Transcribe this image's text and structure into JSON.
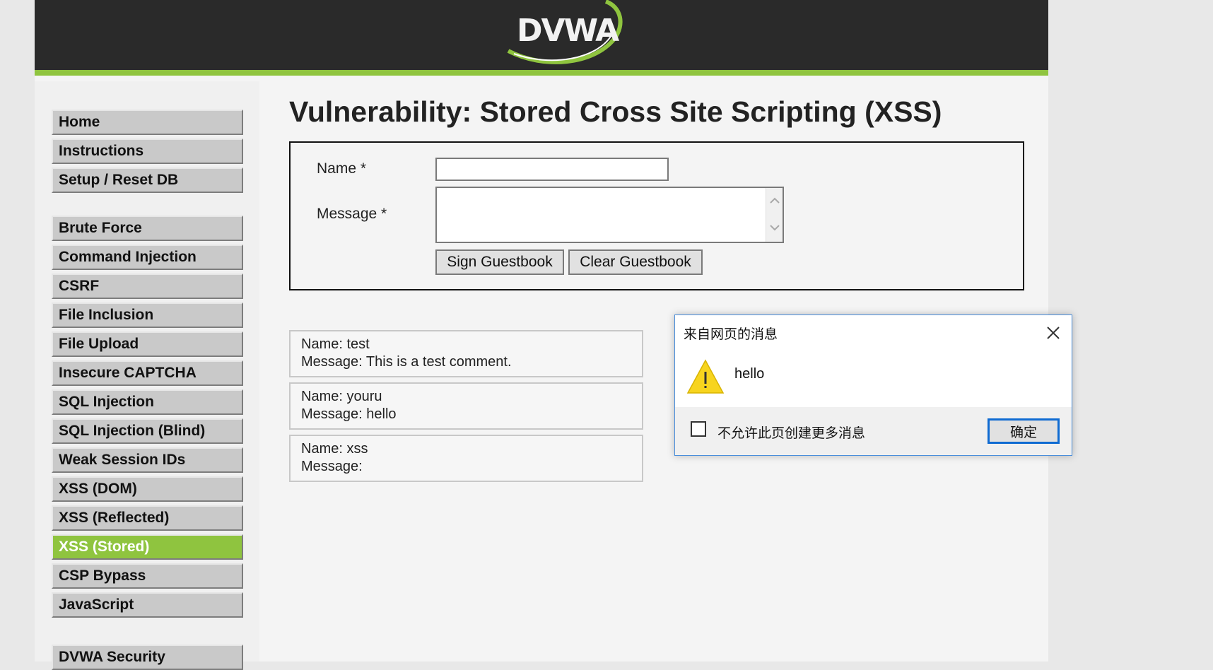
{
  "header": {
    "logo_text": "DVWA"
  },
  "sidebar": {
    "groups": [
      [
        "Home",
        "Instructions",
        "Setup / Reset DB"
      ],
      [
        "Brute Force",
        "Command Injection",
        "CSRF",
        "File Inclusion",
        "File Upload",
        "Insecure CAPTCHA",
        "SQL Injection",
        "SQL Injection (Blind)",
        "Weak Session IDs",
        "XSS (DOM)",
        "XSS (Reflected)",
        "XSS (Stored)",
        "CSP Bypass",
        "JavaScript"
      ],
      [
        "DVWA Security"
      ]
    ],
    "selected": "XSS (Stored)"
  },
  "main": {
    "title": "Vulnerability: Stored Cross Site Scripting (XSS)",
    "form": {
      "name_label": "Name *",
      "message_label": "Message *",
      "name_value": "",
      "message_value": "",
      "sign_button": "Sign Guestbook",
      "clear_button": "Clear Guestbook"
    },
    "entries": [
      {
        "name": "Name: test",
        "message": "Message: This is a test comment."
      },
      {
        "name": "Name: youru",
        "message": "Message: hello"
      },
      {
        "name": "Name: xss",
        "message": "Message:"
      }
    ]
  },
  "dialog": {
    "title": "来自网页的消息",
    "message": "hello",
    "checkbox_label": "不允许此页创建更多消息",
    "ok_button": "确定",
    "icon": "warning-icon"
  },
  "colors": {
    "accent_green": "#8fc43f",
    "header_bg": "#2a2a2a",
    "dialog_border": "#4a8edb"
  }
}
